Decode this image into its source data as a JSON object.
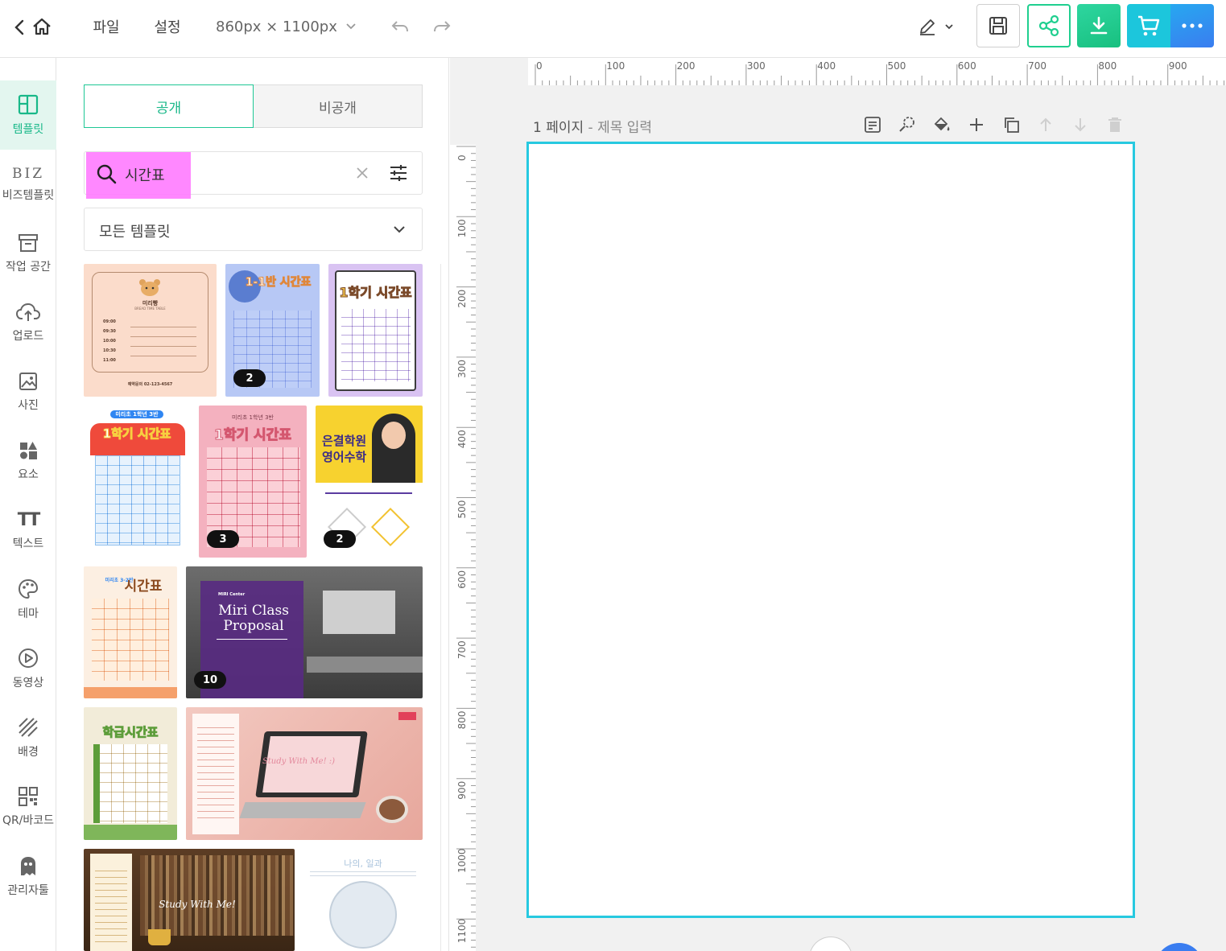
{
  "topbar": {
    "file_label": "파일",
    "settings_label": "설정",
    "canvas_size": "860px × 1100px",
    "colors": {
      "save": "#ffffff",
      "share": "#ffffff",
      "download": "#1fcf8f",
      "cart": "#1cc6dc",
      "more": "#2f86f2"
    }
  },
  "rail": {
    "items": [
      {
        "label": "템플릿",
        "icon": "layout-icon",
        "active": true
      },
      {
        "label": "비즈템플릿",
        "icon": "biz-icon",
        "badge_text": "BIZ"
      },
      {
        "label": "작업 공간",
        "icon": "archive-icon"
      },
      {
        "label": "업로드",
        "icon": "cloud-upload-icon"
      },
      {
        "label": "사진",
        "icon": "photo-icon"
      },
      {
        "label": "요소",
        "icon": "shapes-icon"
      },
      {
        "label": "텍스트",
        "icon": "text-icon",
        "badge_text": "TT"
      },
      {
        "label": "테마",
        "icon": "palette-icon"
      },
      {
        "label": "동영상",
        "icon": "play-icon"
      },
      {
        "label": "배경",
        "icon": "background-icon"
      },
      {
        "label": "QR/바코드",
        "icon": "qr-icon"
      },
      {
        "label": "관리자툴",
        "icon": "admin-icon"
      }
    ]
  },
  "panel": {
    "tabs": [
      {
        "label": "공개",
        "active": true
      },
      {
        "label": "비공개",
        "active": false
      }
    ],
    "search": {
      "value": "시간표"
    },
    "filter": {
      "selected": "모든 템플릿"
    },
    "templates": [
      {
        "title": "미리빵",
        "subtitle": "BREAD TIME TABLE",
        "rows": [
          "09:00",
          "09:30",
          "10:00",
          "10:30",
          "11:00"
        ],
        "phone": "예약문의 02-123-4567"
      },
      {
        "title": "1-1반 시간표",
        "badge": "2"
      },
      {
        "title": "1학기 시간표"
      },
      {
        "title": "1학기 시간표",
        "top": "미리초 1학년 3반"
      },
      {
        "title": "1학기 시간표",
        "top": "미리초 1학년 3반",
        "badge": "3"
      },
      {
        "title": "은결학원 영어수학",
        "badge": "2"
      },
      {
        "title": "시간표",
        "top": "미리초 3-2반"
      },
      {
        "title": "Miri Class Proposal",
        "top": "MIRI Center",
        "badge": "10"
      },
      {
        "title": "학급시간표"
      },
      {
        "title": "Study With Me! :)"
      },
      {
        "title": "Study With Me!"
      },
      {
        "title": "나의, 일과"
      }
    ]
  },
  "canvas": {
    "page_label": "1 페이지",
    "page_title_placeholder": "제목 입력",
    "ruler_top": [
      "0",
      "100",
      "200",
      "300",
      "400",
      "500",
      "600",
      "700",
      "800",
      "900"
    ],
    "ruler_left": [
      "0",
      "100",
      "200",
      "300",
      "400",
      "500",
      "600",
      "700",
      "800",
      "900",
      "1000",
      "1100"
    ],
    "page_border_color": "#27c9e0"
  }
}
